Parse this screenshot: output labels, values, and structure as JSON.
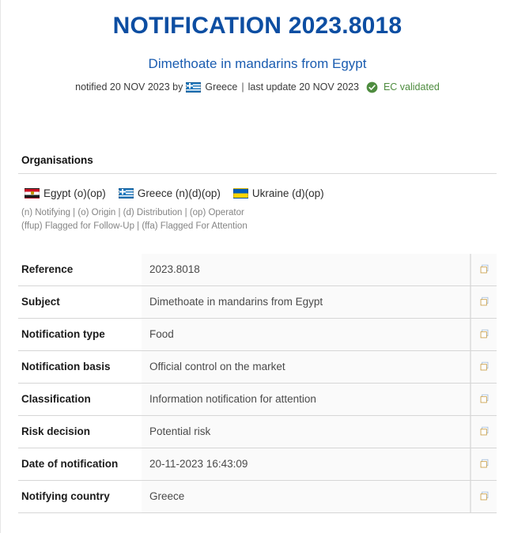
{
  "header": {
    "title": "NOTIFICATION 2023.8018",
    "subtitle": "Dimethoate in mandarins from Egypt",
    "notified_prefix": "notified 20 NOV 2023 by",
    "notifier_country": "Greece",
    "separator": "|",
    "last_update": "last update 20 NOV 2023",
    "validation_label": "EC validated",
    "validation_icon": "check-circle-icon",
    "validation_color": "#4e8c3f",
    "title_color": "#0d4ea2",
    "subtitle_color": "#1a5cb0"
  },
  "organisations": {
    "section_title": "Organisations",
    "items": [
      {
        "flag": "egypt",
        "name": "Egypt",
        "roles": "(o)(op)"
      },
      {
        "flag": "greece",
        "name": "Greece",
        "roles": "(n)(d)(op)"
      },
      {
        "flag": "ukraine",
        "name": "Ukraine",
        "roles": "(d)(op)"
      }
    ],
    "legend_line1": "(n) Notifying | (o) Origin | (d) Distribution | (op) Operator",
    "legend_line2": "(ffup) Flagged for Follow-Up | (ffa) Flagged For Attention"
  },
  "details": {
    "copy_icon": "copy-icon",
    "rows": [
      {
        "label": "Reference",
        "value": "2023.8018"
      },
      {
        "label": "Subject",
        "value": "Dimethoate in mandarins from Egypt"
      },
      {
        "label": "Notification type",
        "value": "Food"
      },
      {
        "label": "Notification basis",
        "value": "Official control on the market"
      },
      {
        "label": "Classification",
        "value": "Information notification for attention"
      },
      {
        "label": "Risk decision",
        "value": "Potential risk"
      },
      {
        "label": "Date of notification",
        "value": "20-11-2023 16:43:09"
      },
      {
        "label": "Notifying country",
        "value": "Greece"
      }
    ]
  }
}
